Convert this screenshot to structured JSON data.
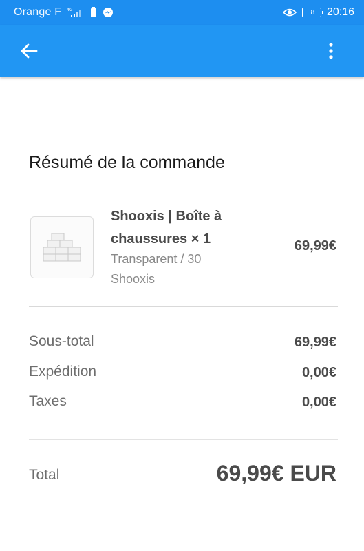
{
  "status_bar": {
    "carrier": "Orange F",
    "network": "4G",
    "battery_level": "8",
    "time": "20:16",
    "icons": [
      "signal-icon",
      "battery-saver-icon",
      "messenger-icon",
      "eye-comfort-icon",
      "battery-icon"
    ],
    "battery_color": "#ff4d4d"
  },
  "app_bar": {
    "background": "#2196f3",
    "back_icon": "arrow-left-icon",
    "menu_icon": "more-vert-icon"
  },
  "order_summary": {
    "title": "Résumé de la commande",
    "product": {
      "image_icon": "shoe-box-icon",
      "name": "Shooxis | Boîte à chaussures × 1",
      "variant": "Transparent / 30",
      "vendor": "Shooxis",
      "price": "69,99€"
    },
    "lines": [
      {
        "label": "Sous-total",
        "value": "69,99€"
      },
      {
        "label": "Expédition",
        "value": "0,00€"
      },
      {
        "label": "Taxes",
        "value": "0,00€"
      }
    ],
    "total": {
      "label": "Total",
      "value": "69,99€ EUR"
    }
  }
}
